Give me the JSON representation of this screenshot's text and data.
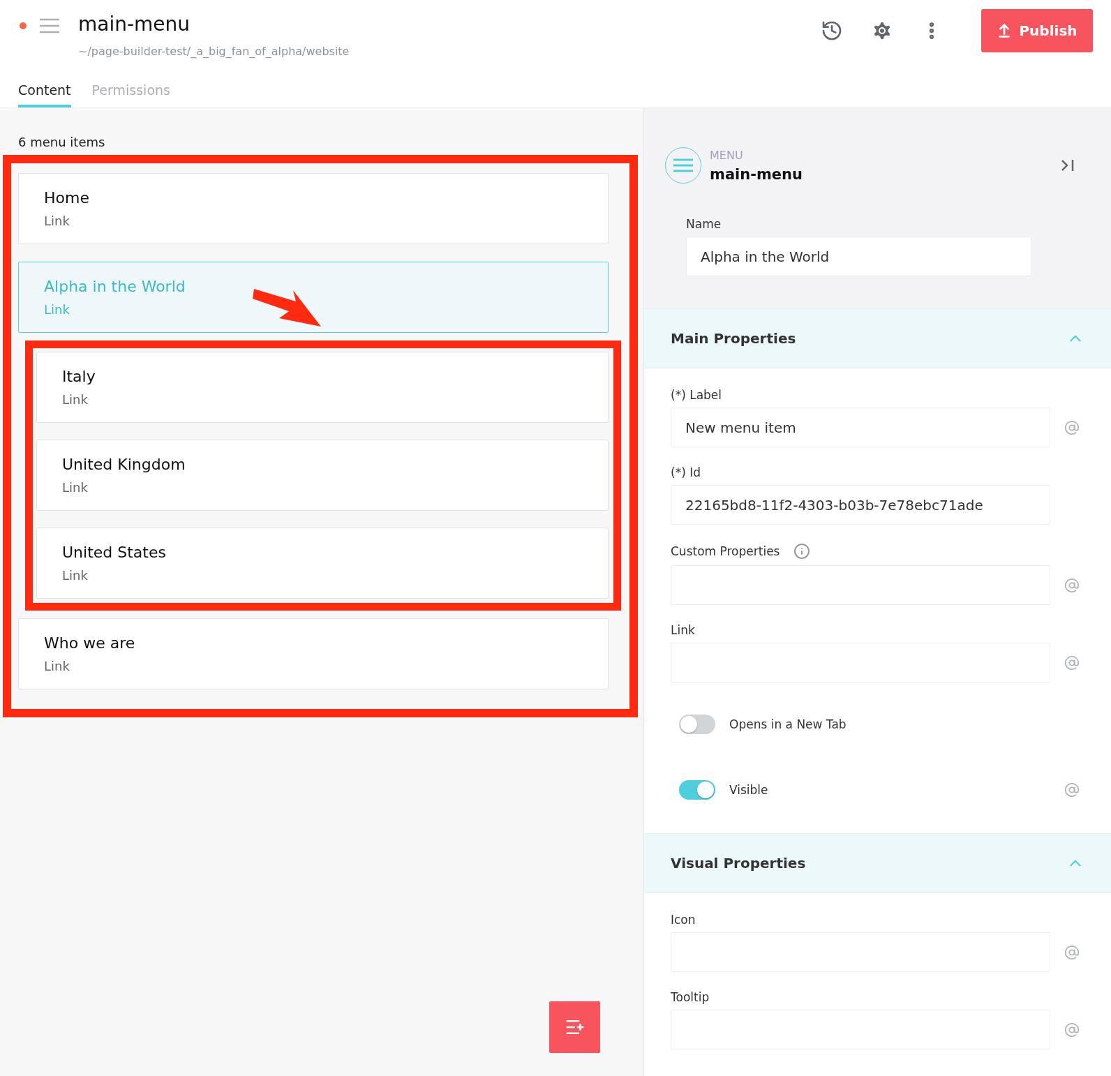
{
  "header": {
    "title": "main-menu",
    "path": "~/page-builder-test/_a_big_fan_of_alpha/website",
    "unsaved": true,
    "publish_label": "Publish"
  },
  "tabs": [
    {
      "label": "Content",
      "selected": true
    },
    {
      "label": "Permissions",
      "selected": false
    }
  ],
  "menu_count": "6 menu items",
  "menu_items": [
    {
      "title": "Home",
      "type": "Link",
      "selected": false
    },
    {
      "title": "Alpha in the World",
      "type": "Link",
      "selected": true,
      "children": [
        {
          "title": "Italy",
          "type": "Link",
          "selected": false
        },
        {
          "title": "United Kingdom",
          "type": "Link",
          "selected": false
        },
        {
          "title": "United States",
          "type": "Link",
          "selected": false
        }
      ]
    },
    {
      "title": "Who we are",
      "type": "Link",
      "selected": false
    }
  ],
  "panel": {
    "kicker": "MENU",
    "title": "main-menu",
    "name_label": "Name",
    "name_value": "Alpha in the World"
  },
  "sections": [
    {
      "title": "Main Properties",
      "expanded": true,
      "fields": [
        {
          "kind": "text",
          "label": "(*) Label",
          "value": "New menu item",
          "binding": true
        },
        {
          "kind": "text",
          "label": "(*) Id",
          "value": "22165bd8-11f2-4303-b03b-7e78ebc71ade",
          "binding": false
        },
        {
          "kind": "text",
          "label": "Custom Properties",
          "info": true,
          "binding": true
        },
        {
          "kind": "text",
          "label": "Link",
          "binding": true
        },
        {
          "kind": "toggle",
          "label": "Opens in a New Tab",
          "on": false,
          "binding": false
        },
        {
          "kind": "toggle",
          "label": "Visible",
          "on": true,
          "binding": true
        }
      ]
    },
    {
      "title": "Visual Properties",
      "expanded": true,
      "fields": [
        {
          "kind": "text",
          "label": "Icon",
          "binding": true
        },
        {
          "kind": "text",
          "label": "Tooltip",
          "binding": true
        }
      ]
    }
  ]
}
